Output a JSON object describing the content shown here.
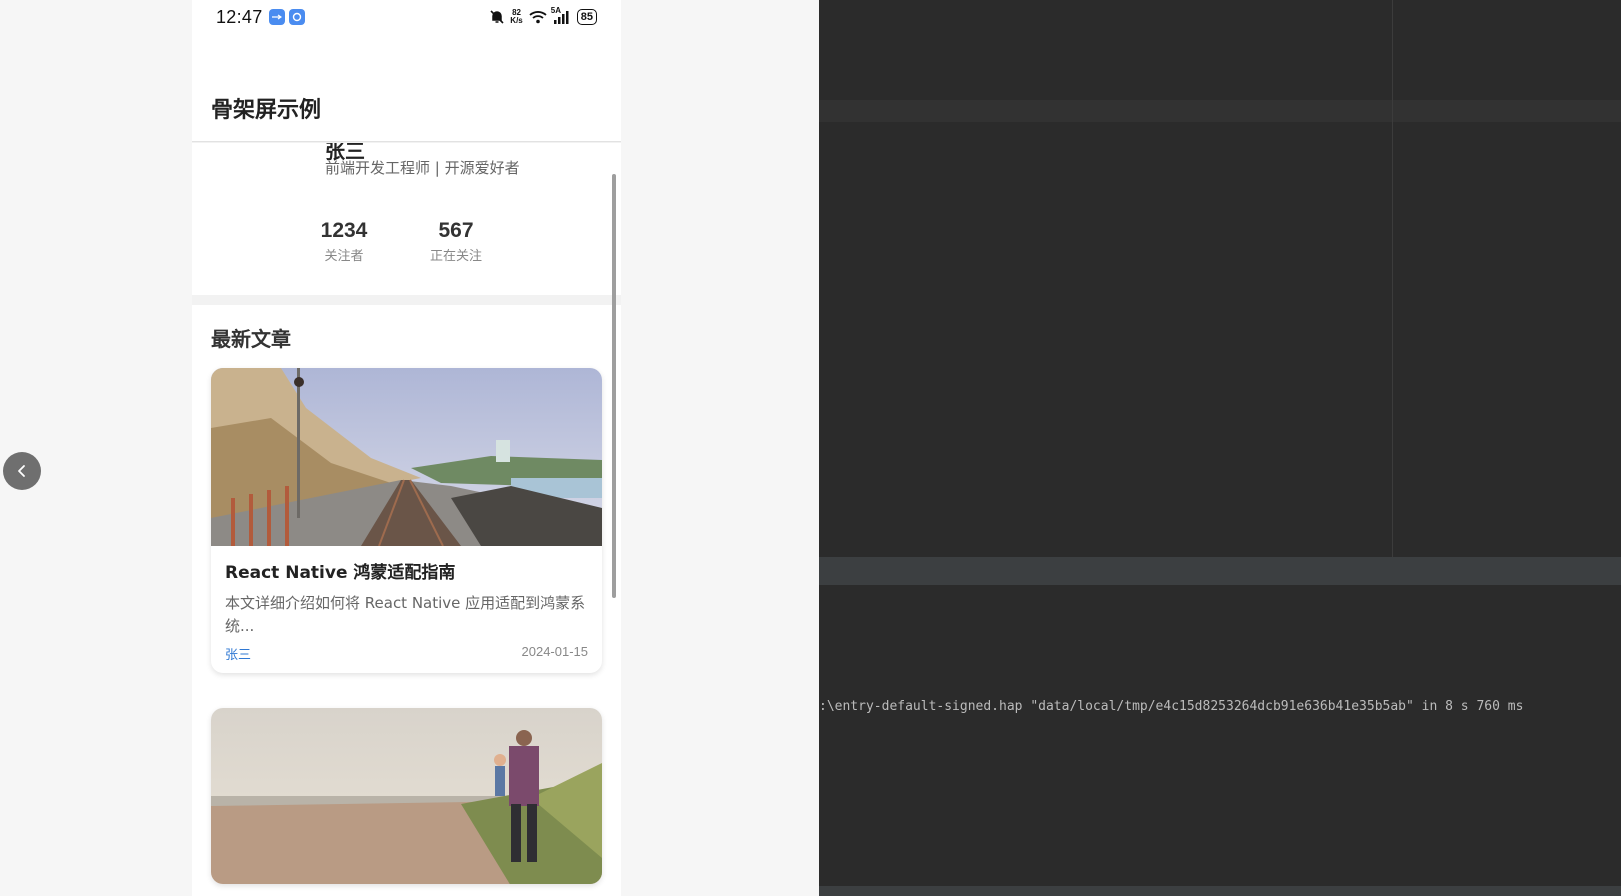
{
  "statusbar": {
    "time": "12:47",
    "net_speed_value": "82",
    "net_speed_unit": "K/s",
    "signal_label": "5A",
    "battery": "85"
  },
  "header": {
    "title": "骨架屏示例"
  },
  "profile": {
    "name": "张三",
    "bio": "前端开发工程师 | 开源爱好者",
    "stats": [
      {
        "value": "1234",
        "label": "关注者"
      },
      {
        "value": "567",
        "label": "正在关注"
      }
    ]
  },
  "articles": {
    "section_title": "最新文章",
    "items": [
      {
        "title": "React Native 鸿蒙适配指南",
        "desc": "本文详细介绍如何将 React Native 应用适配到鸿蒙系统...",
        "author": "张三",
        "date": "2024-01-15"
      }
    ]
  },
  "ide": {
    "log_line": ":\\entry-default-signed.hap \"data/local/tmp/e4c15d8253264dcb91e636b41e35b5ab\" in 8 s 760 ms"
  },
  "colors": {
    "accent_link": "#2f78d3",
    "ide_background": "#2b2b2b",
    "phone_background": "#f2f2f2"
  }
}
